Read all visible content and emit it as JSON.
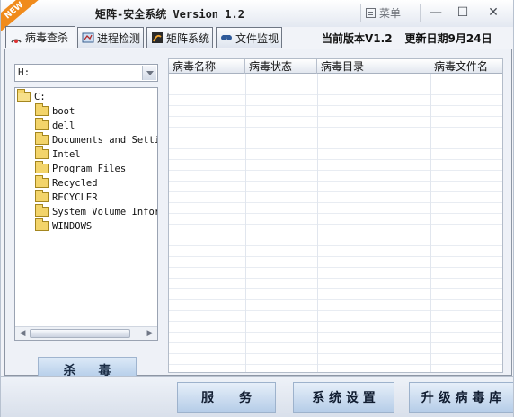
{
  "window": {
    "badge": "NEW",
    "title": "矩阵-安全系统 Version 1.2",
    "menu_label": "菜单",
    "min_symbol": "—",
    "max_symbol": "☐",
    "close_symbol": "✕"
  },
  "tabs": [
    {
      "label": "病毒查杀",
      "active": true
    },
    {
      "label": "进程检测",
      "active": false
    },
    {
      "label": "矩阵系统",
      "active": false
    },
    {
      "label": "文件监视",
      "active": false
    }
  ],
  "version_info": {
    "current_version": "当前版本V1.2",
    "update_date": "更新日期9月24日"
  },
  "scan": {
    "drive_value": "H:",
    "tree_root": "C:",
    "tree_items": [
      "boot",
      "dell",
      "Documents and Settin",
      "Intel",
      "Program Files",
      "Recycled",
      "RECYCLER",
      "System Volume Inform",
      "WINDOWS"
    ],
    "kill_button": "杀 毒",
    "columns": [
      "病毒名称",
      "病毒状态",
      "病毒目录",
      "病毒文件名"
    ]
  },
  "bottom": {
    "service_button": "服　　务",
    "settings_button": "系 统 设 置",
    "upgrade_button": "升 级 病 毒 库"
  },
  "colors": {
    "badge": "#f08b1c",
    "button_gradient_top": "#e6eff9",
    "button_gradient_bottom": "#b6cde8",
    "folder": "#f3d46a"
  }
}
